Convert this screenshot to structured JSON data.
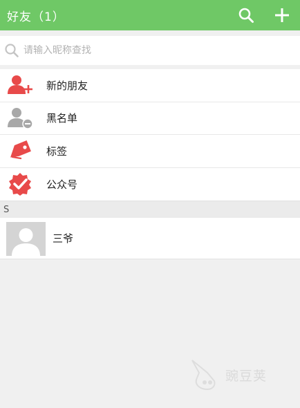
{
  "header": {
    "title": "好友（1）",
    "search_icon": "search-icon",
    "add_icon": "plus-icon",
    "background": "#6fc866"
  },
  "search": {
    "placeholder": "请输入昵称查找",
    "value": ""
  },
  "menu": {
    "items": [
      {
        "label": "新的朋友",
        "icon": "add-friend-icon",
        "icon_color": "#e84a4a"
      },
      {
        "label": "黑名单",
        "icon": "blacklist-icon",
        "icon_color": "#a8a8a8"
      },
      {
        "label": "标签",
        "icon": "tag-icon",
        "icon_color": "#e84a4a"
      },
      {
        "label": "公众号",
        "icon": "official-account-icon",
        "icon_color": "#e84a4a"
      }
    ]
  },
  "contacts": {
    "section_letter": "S",
    "items": [
      {
        "name": "三爷",
        "avatar": "default-avatar"
      }
    ]
  },
  "watermark": {
    "text": "豌豆荚"
  }
}
